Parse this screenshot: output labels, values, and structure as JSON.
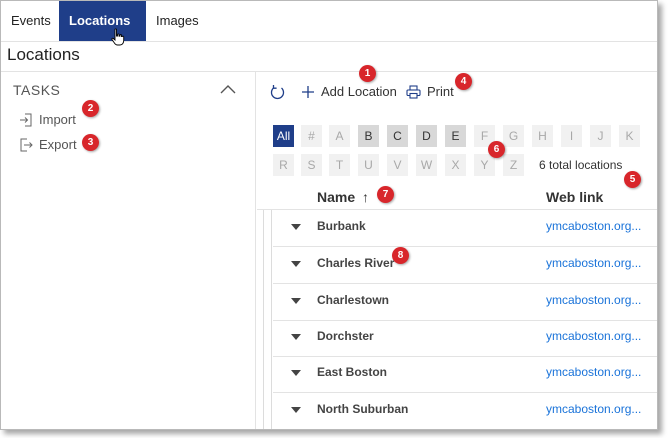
{
  "colors": {
    "nav_active_bg": "#1f3e89",
    "link": "#1a73d9",
    "callout": "#d8262b",
    "letter_enabled_bg": "#d8d8d8",
    "letter_disabled_bg": "#f1f1f1"
  },
  "nav": {
    "items": [
      {
        "label": "Events"
      },
      {
        "label": "Locations",
        "icon": "caret-down-icon"
      },
      {
        "label": "Images"
      }
    ]
  },
  "page": {
    "title": "Locations"
  },
  "tasks": {
    "header": "TASKS",
    "items": [
      {
        "label": "Import",
        "icon": "import-icon"
      },
      {
        "label": "Export",
        "icon": "export-icon"
      }
    ]
  },
  "toolbar": {
    "refresh_icon": "refresh-icon",
    "add_label": "Add Location",
    "print_label": "Print"
  },
  "filter": {
    "letters": [
      "All",
      "#",
      "A",
      "B",
      "C",
      "D",
      "E",
      "F",
      "G",
      "H",
      "I",
      "J",
      "K",
      "R",
      "S",
      "T",
      "U",
      "V",
      "W",
      "X",
      "Y",
      "Z"
    ],
    "selected": "All",
    "enabled": [
      "All",
      "B",
      "C",
      "D",
      "E"
    ],
    "total_text": "6 total locations"
  },
  "table": {
    "columns": [
      {
        "label": "Name",
        "sort": "↑"
      },
      {
        "label": "Web link"
      }
    ],
    "rows": [
      {
        "name": "Burbank",
        "link": "ymcaboston.org..."
      },
      {
        "name": "Charles River",
        "link": "ymcaboston.org..."
      },
      {
        "name": "Charlestown",
        "link": "ymcaboston.org..."
      },
      {
        "name": "Dorchster",
        "link": "ymcaboston.org..."
      },
      {
        "name": "East Boston",
        "link": "ymcaboston.org..."
      },
      {
        "name": "North Suburban",
        "link": "ymcaboston.org..."
      }
    ]
  },
  "callouts": [
    "1",
    "2",
    "3",
    "4",
    "5",
    "6",
    "7",
    "8"
  ]
}
